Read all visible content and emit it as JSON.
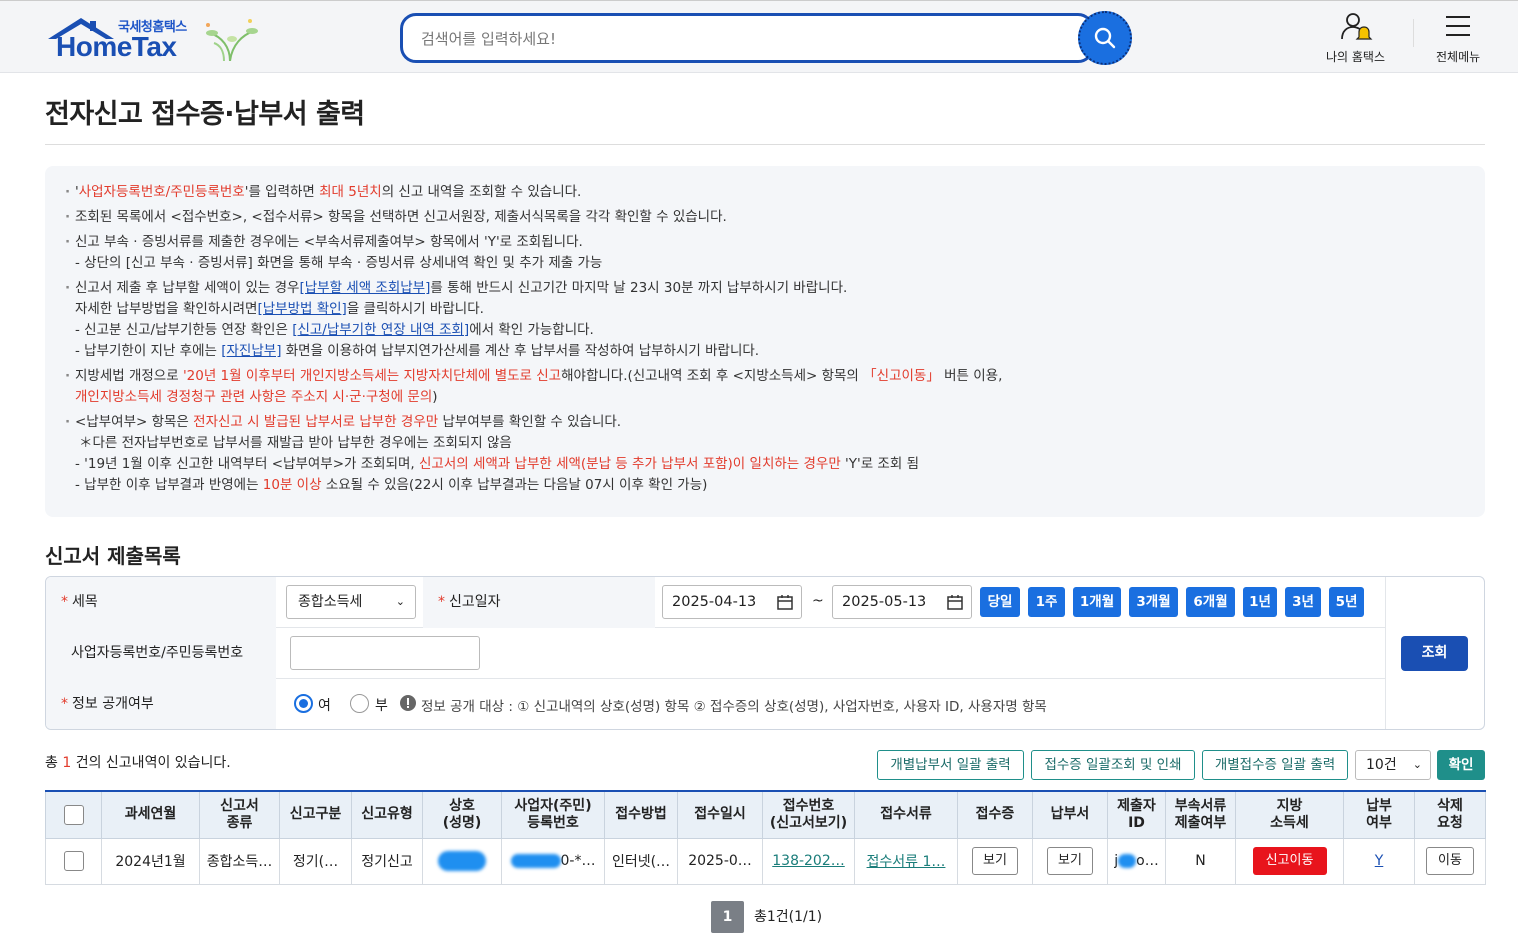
{
  "header": {
    "logo_sub": "국세청홈택스",
    "logo_main": "HomeTax",
    "search_placeholder": "검색어를 입력하세요!",
    "my_hometax": "나의 홈택스",
    "all_menu": "전체메뉴"
  },
  "page": {
    "title": "전자신고 접수증·납부서 출력"
  },
  "notice": {
    "l1_a": "'",
    "l1_b": "사업자등록번호/주민등록번호",
    "l1_c": "'를 입력하면 ",
    "l1_d": "최대 5년치",
    "l1_e": "의 신고 내역을 조회할 수 있습니다.",
    "l2": "조회된 목록에서 <접수번호>, <접수서류> 항목을 선택하면 신고서원장, 제출서식목록을 각각 확인할 수 있습니다.",
    "l3": "신고 부속 · 증빙서류를 제출한 경우에는 <부속서류제출여부> 항목에서 'Y'로 조회됩니다.",
    "l3_sub": "- 상단의 [신고 부속 · 증빙서류] 화면을 통해 부속 · 증빙서류 상세내역 확인 및 추가 제출 가능",
    "l4_a": "신고서 제출 후 납부할 세액이 있는 경우",
    "l4_link": "[납부할 세액 조회납부]",
    "l4_b": "를 통해 반드시 신고기간 마지막 날 23시 30분 까지 납부하시기 바랍니다.",
    "l4_2a": "자세한 납부방법을 확인하시려면",
    "l4_2link": "[납부방법 확인]",
    "l4_2b": "을 클릭하시기 바랍니다.",
    "l4_3a": "- 신고분 신고/납부기한등 연장 확인은 ",
    "l4_3link": "[신고/납부기한 연장 내역 조회]",
    "l4_3b": "에서 확인 가능합니다.",
    "l4_4a": "- 납부기한이 지난 후에는 ",
    "l4_4link": "[자진납부]",
    "l4_4b": " 화면을 이용하여 납부지연가산세를 계산 후 납부서를 작성하여 납부하시기 바랍니다.",
    "l5_a": "지방세법 개정으로 ",
    "l5_b": "'20년 1월 이후부터 개인지방소득세는 지방자치단체에 별도로 신고",
    "l5_c": "해야합니다.(신고내역 조회 후 <지방소득세> 항목의 ",
    "l5_d": "「신고이동」",
    "l5_e": " 버튼 이용,",
    "l5_2": "개인지방소득세 경정청구 관련 사항은 주소지 시·군·구청에 문의",
    "l5_2b": ")",
    "l6_a": "<납부여부> 항목은 ",
    "l6_b": "전자신고 시 발급된 납부서로 납부한 경우만",
    "l6_c": " 납부여부를 확인할 수 있습니다.",
    "l6_2": "＊다른 전자납부번호로 납부서를 재발급 받아 납부한 경우에는 조회되지 않음",
    "l6_3a": "- '19년 1월 이후 신고한 내역부터 <납부여부>가 조회되며, ",
    "l6_3b": "신고서의 세액과 납부한 세액(분납 등 추가 납부서 포함)이 일치하는 경우만",
    "l6_3c": " 'Y'로 조회 됨",
    "l6_4a": "- 납부한 이후 납부결과 반영에는 ",
    "l6_4b": "10분 이상",
    "l6_4c": " 소요될 수 있음(22시 이후 납부결과는 다음날 07시 이후 확인 가능)"
  },
  "section": {
    "title": "신고서 제출목록"
  },
  "form": {
    "tax_type_label": "세목",
    "tax_type_value": "종합소득세",
    "date_label": "신고일자",
    "date_from": "2025-04-13",
    "date_tilde": "~",
    "date_to": "2025-05-13",
    "periods": [
      "당일",
      "1주",
      "1개월",
      "3개월",
      "6개월",
      "1년",
      "3년",
      "5년"
    ],
    "id_label": "사업자등록번호/주민등록번호",
    "id_value": "",
    "disclose_label": "정보 공개여부",
    "radio_yes": "여",
    "radio_no": "부",
    "disclose_note": "정보 공개 대상 : ① 신고내역의 상호(성명) 항목 ② 접수증의 상호(성명), 사업자번호, 사용자 ID, 사용자명 항목",
    "search_button": "조회"
  },
  "results": {
    "total_prefix": "총 ",
    "total_count": "1",
    "total_suffix": " 건의 신고내역이 있습니다.",
    "btn_bulk_payment": "개별납부서 일괄 출력",
    "btn_bulk_receipt_print": "접수증 일괄조회 및 인쇄",
    "btn_bulk_receipt": "개별접수증 일괄 출력",
    "page_size": "10건",
    "confirm": "확인"
  },
  "table": {
    "headers": [
      "",
      "과세연월",
      "신고서\n종류",
      "신고구분",
      "신고유형",
      "상호\n(성명)",
      "사업자(주민)\n등록번호",
      "접수방법",
      "접수일시",
      "접수번호\n(신고서보기)",
      "접수서류",
      "접수증",
      "납부서",
      "제출자\nID",
      "부속서류\n제출여부",
      "지방\n소득세",
      "납부\n여부",
      "삭제\n요청"
    ],
    "rows": [
      {
        "period": "2024년1월",
        "form_type": "종합소득…",
        "category": "정기(…",
        "report_type": "정기신고",
        "reg_no_tail": "0-*…",
        "method": "인터넷(…",
        "received_at": "2025-0…",
        "receipt_no": "138-202…",
        "documents": "접수서류 1…",
        "receipt_btn": "보기",
        "payment_btn": "보기",
        "submitter_a": "j",
        "submitter_b": "o…",
        "attach": "N",
        "local_tax_btn": "신고이동",
        "paid": "Y",
        "delete_btn": "이동"
      }
    ]
  },
  "pagination": {
    "current": "1",
    "info": "총1건(1/1)"
  },
  "colors": {
    "brand_blue": "#1a4fb3",
    "accent_blue": "#1a6fe0",
    "teal": "#1f8f8a",
    "red": "#e23b2c",
    "alert_red": "#e8141c"
  }
}
